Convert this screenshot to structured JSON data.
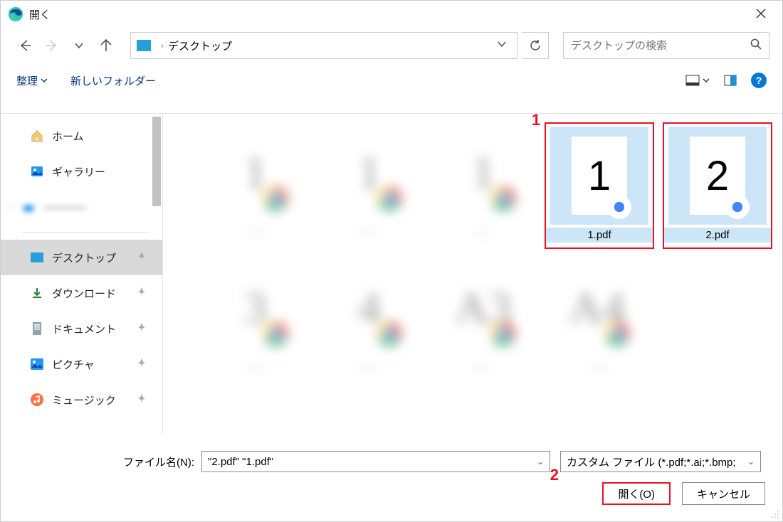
{
  "window": {
    "title": "開く"
  },
  "nav": {
    "location": "デスクトップ"
  },
  "search": {
    "placeholder": "デスクトップの検索"
  },
  "toolbar": {
    "organize": "整理",
    "newfolder": "新しいフォルダー"
  },
  "sidebar": {
    "home": "ホーム",
    "gallery": "ギャラリー",
    "blurred": "————",
    "desktop": "デスクトップ",
    "downloads": "ダウンロード",
    "documents": "ドキュメント",
    "pictures": "ピクチャ",
    "music": "ミュージック"
  },
  "files": {
    "f1": {
      "name": "1.pdf",
      "glyph": "1"
    },
    "f2": {
      "name": "2.pdf",
      "glyph": "2"
    }
  },
  "annotations": {
    "a1": "1",
    "a2": "2"
  },
  "bottom": {
    "filename_label": "ファイル名(N):",
    "filename_value": "\"2.pdf\" \"1.pdf\"",
    "filter_value": "カスタム ファイル (*.pdf;*.ai;*.bmp;",
    "open_btn": "開く(O)",
    "cancel_btn": "キャンセル"
  }
}
